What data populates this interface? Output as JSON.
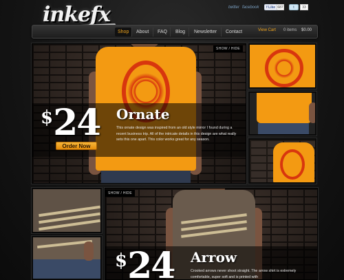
{
  "header": {
    "logo": "inkefx",
    "social": {
      "twitter": "twitter",
      "facebook": "facebook",
      "like_label": "f Like",
      "like_count": "687",
      "tweet_label": "t",
      "tweet_count": "33"
    }
  },
  "nav": {
    "items": [
      "Shop",
      "About",
      "FAQ",
      "Blog",
      "Newsletter",
      "Contact"
    ],
    "active": "Shop",
    "cart_label": "View Cart",
    "cart_items": "0 items",
    "cart_total": "$0.00"
  },
  "products": [
    {
      "show_hide": "SHOW / HIDE",
      "dollar": "$",
      "price": "24",
      "title": "Ornate",
      "description": "This ornate design was inspired from an old style mirror I found during a recent business trip. All of the intricate details in this design are what really sets this one apart. This color works great for any season.",
      "order_label": "Order Now",
      "shirt_color": "#f39a12",
      "print_color": "#d8360e"
    },
    {
      "show_hide": "SHOW / HIDE",
      "dollar": "$",
      "price": "24",
      "title": "Arrow",
      "description": "Crooked arrows never shoot straight. The arrow shirt is extremely comfortable, super soft and is printed with",
      "shirt_color": "#6a5b4d",
      "print_color": "#cdbd95"
    }
  ]
}
